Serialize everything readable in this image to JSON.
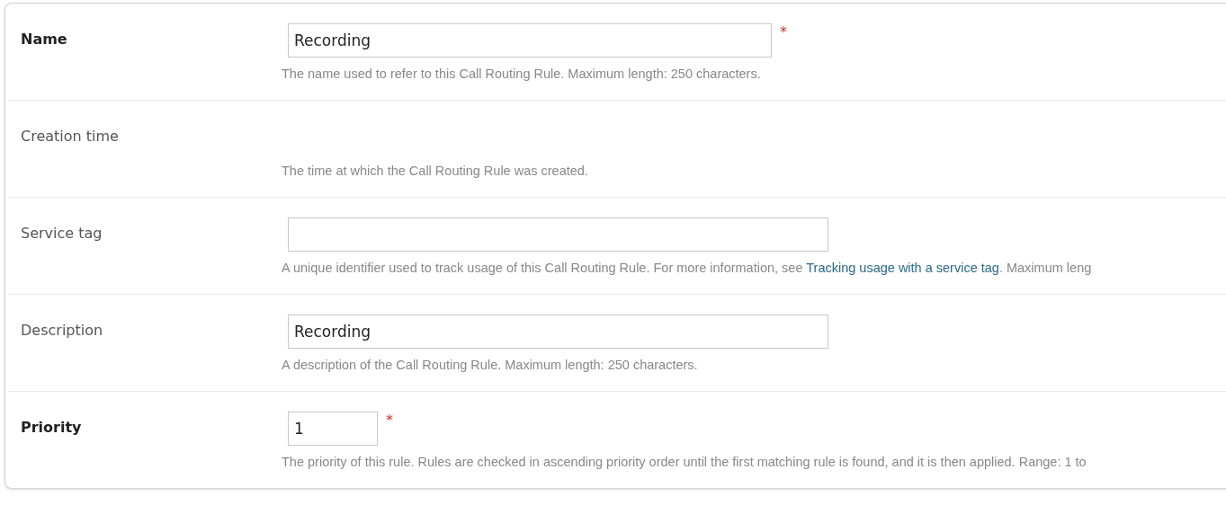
{
  "rows": [
    {
      "label": "Name",
      "required": true,
      "marker": "*",
      "field": {
        "kind": "medium",
        "value": "Recording"
      },
      "help": "The name used to refer to this Call Routing Rule. Maximum length: 250 characters."
    },
    {
      "label": "Creation time",
      "required": false,
      "help": "The time at which the Call Routing Rule was created."
    },
    {
      "label": "Service tag",
      "required": false,
      "field": {
        "kind": "long"
      },
      "help": "A unique identifier used to track usage of this Call Routing Rule. For more information, see ",
      "link": "Tracking usage with a service tag",
      "help_after": ". Maximum leng"
    },
    {
      "label": "Description",
      "required": false,
      "field": {
        "kind": "long",
        "value": "Recording"
      },
      "help": "A description of the Call Routing Rule. Maximum length: 250 characters."
    },
    {
      "label": "Priority",
      "required": true,
      "marker": "*",
      "field": {
        "kind": "short",
        "value": "1"
      },
      "help": "The priority of this rule. Rules are checked in ascending priority order until the first matching rule is found, and it is then applied. Range: 1 to"
    }
  ]
}
